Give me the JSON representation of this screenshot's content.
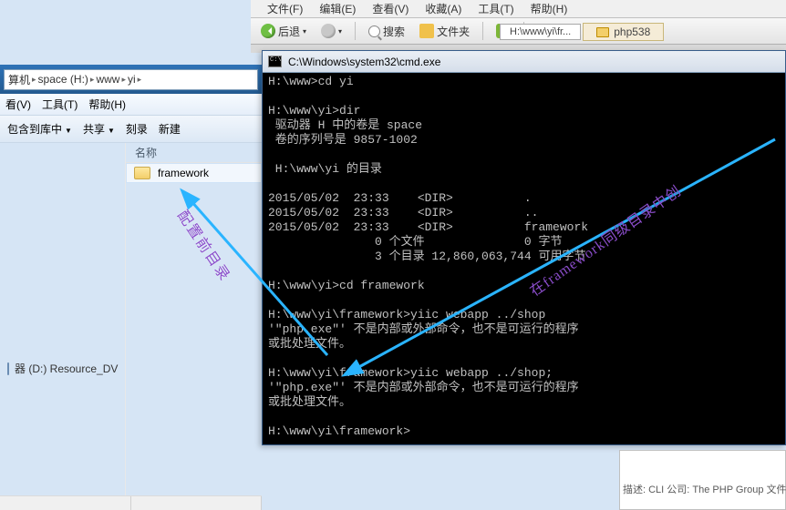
{
  "back_window": {
    "menus": [
      "文件(F)",
      "编辑(E)",
      "查看(V)",
      "收藏(A)",
      "工具(T)",
      "帮助(H)"
    ],
    "toolbar": {
      "back": "后退",
      "search": "搜索",
      "folders": "文件夹"
    },
    "tab_a": "H:\\www\\yi\\fr...",
    "tab_b": "php538"
  },
  "explorer": {
    "breadcrumb": [
      "算机",
      "space (H:)",
      "www",
      "yi"
    ],
    "menus": [
      "看(V)",
      "工具(T)",
      "帮助(H)"
    ],
    "toolbar": {
      "org": "包含到库中",
      "share": "共享",
      "burn": "刻录",
      "new": "新建"
    },
    "list_header": "名称",
    "folder_name": "framework",
    "nav_item": "器 (D:) Resource_DV"
  },
  "cmd": {
    "title": "C:\\Windows\\system32\\cmd.exe",
    "lines": [
      "H:\\www>cd yi",
      "",
      "H:\\www\\yi>dir",
      " 驱动器 H 中的卷是 space",
      " 卷的序列号是 9857-1002",
      "",
      " H:\\www\\yi 的目录",
      "",
      "2015/05/02  23:33    <DIR>          .",
      "2015/05/02  23:33    <DIR>          ..",
      "2015/05/02  23:33    <DIR>          framework",
      "               0 个文件              0 字节",
      "               3 个目录 12,860,063,744 可用字节",
      "",
      "H:\\www\\yi>cd framework",
      "",
      "H:\\www\\yi\\framework>yiic webapp ../shop",
      "'\"php.exe\"' 不是内部或外部命令，也不是可运行的程序",
      "或批处理文件。",
      "",
      "H:\\www\\yi\\framework>yiic webapp ../shop;",
      "'\"php.exe\"' 不是内部或外部命令，也不是可运行的程序",
      "或批处理文件。",
      "",
      "H:\\www\\yi\\framework>"
    ]
  },
  "bottom": {
    "desc": "描述: CLI 公司: The PHP Group 文件版"
  },
  "annotations": {
    "a1": "配置前目录",
    "a2": "在framework同级目录中创"
  }
}
